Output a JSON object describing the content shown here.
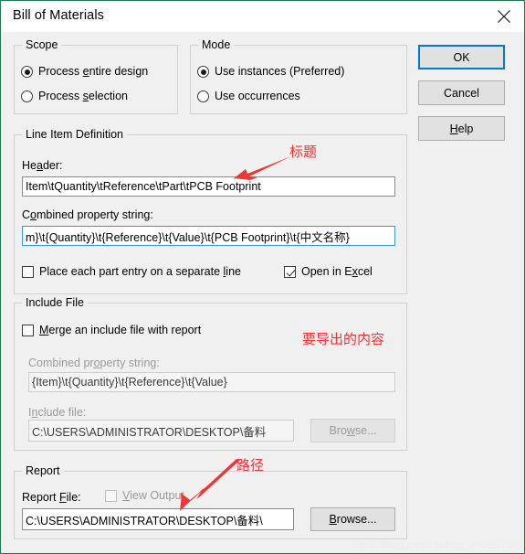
{
  "window": {
    "title": "Bill of Materials",
    "close_icon": "close-icon",
    "accent_border": "#1d7a4c"
  },
  "scope": {
    "legend": "Scope",
    "options": [
      {
        "label_pre": "Process ",
        "label_accel": "e",
        "label_post": "ntire design",
        "checked": true
      },
      {
        "label_pre": "Process ",
        "label_accel": "s",
        "label_post": "election",
        "checked": false
      }
    ]
  },
  "mode": {
    "legend": "Mode",
    "options": [
      {
        "label_pre": "Use instances (Preferred)",
        "label_accel": "",
        "label_post": "",
        "checked": true
      },
      {
        "label_pre": "Use occurrences",
        "label_accel": "",
        "label_post": "",
        "checked": false
      }
    ]
  },
  "buttons": {
    "ok": "OK",
    "cancel": "Cancel",
    "help_pre": "",
    "help_accel": "H",
    "help_post": "elp"
  },
  "line_item": {
    "legend": "Line Item Definition",
    "header_label_pre": "He",
    "header_label_accel": "a",
    "header_label_post": "der:",
    "header_value": "Item\\tQuantity\\tReference\\tPart\\tPCB Footprint",
    "combined_label_pre": "C",
    "combined_label_accel": "o",
    "combined_label_post": "mbined property string:",
    "combined_value": "m}\\t{Quantity}\\t{Reference}\\t{Value}\\t{PCB Footprint}\\t{中文名称}",
    "separate_line_pre": "Place each part entry on a separate ",
    "separate_line_accel": "l",
    "separate_line_post": "ine",
    "separate_line_checked": false,
    "open_excel_pre": "Open in E",
    "open_excel_accel": "x",
    "open_excel_post": "cel",
    "open_excel_checked": true
  },
  "include_file": {
    "legend": "Include File",
    "merge_pre": "",
    "merge_accel": "M",
    "merge_post": "erge an include file with report",
    "merge_checked": false,
    "combined_label_pre": "Combined pr",
    "combined_label_accel": "o",
    "combined_label_post": "perty string:",
    "combined_value": "{Item}\\t{Quantity}\\t{Reference}\\t{Value}",
    "file_label_pre": "I",
    "file_label_accel": "n",
    "file_label_post": "clude file:",
    "file_value": "C:\\USERS\\ADMINISTRATOR\\DESKTOP\\备料",
    "browse_pre": "Bro",
    "browse_accel": "w",
    "browse_post": "se..."
  },
  "report": {
    "legend": "Report",
    "file_label_pre": "Report ",
    "file_label_accel": "F",
    "file_label_post": "ile:",
    "view_output_pre": "",
    "view_output_accel": "V",
    "view_output_post": "iew Output",
    "view_output_checked": false,
    "file_value": "C:\\USERS\\ADMINISTRATOR\\DESKTOP\\备料\\",
    "browse_pre": "",
    "browse_accel": "B",
    "browse_post": "rowse..."
  },
  "annotations": [
    {
      "text": "标题",
      "color": "#ff2d2d"
    },
    {
      "text": "要导出的内容",
      "color": "#ff2d2d"
    },
    {
      "text": "路径",
      "color": "#ff2d2d"
    }
  ],
  "watermark": "https://blog.csdn.net/qq_45025738"
}
